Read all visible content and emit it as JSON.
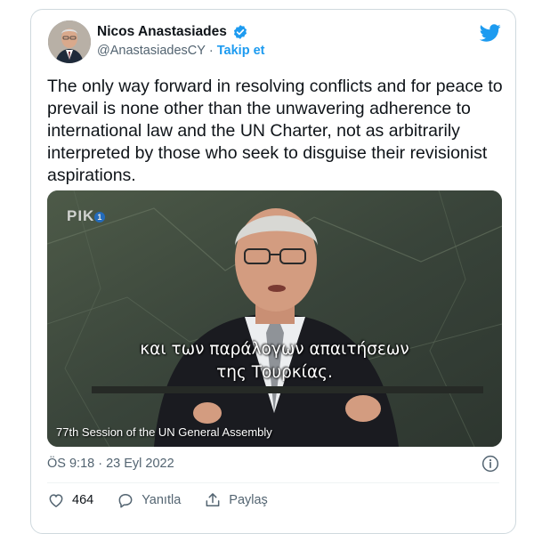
{
  "tweet": {
    "author_name": "Nicos Anastasiades",
    "handle": "@AnastasiadesCY",
    "separator": "·",
    "follow_label": "Takip et",
    "text": "The only way forward in resolving conflicts and for peace to prevail is none other than the unwavering adherence to international law and the UN Charter, not as arbitrarily interpreted by those who seek to disguise their revisionist aspirations.",
    "timestamp": "ÖS 9:18 · 23 Eyl 2022"
  },
  "video": {
    "channel_logo": "PIK",
    "channel_logo_badge": "1",
    "subtitle_line1": "και των παράλογων απαιτήσεων",
    "subtitle_line2": "της Τουρκίας.",
    "caption": "77th Session of the UN General Assembly"
  },
  "actions": {
    "like_count": "464",
    "reply_label": "Yanıtla",
    "share_label": "Paylaş"
  },
  "colors": {
    "accent": "#1d9bf0",
    "muted": "#536471",
    "border": "#cfd9de",
    "like": "#f91880"
  },
  "icons": [
    "avatar-photo",
    "verified-badge-icon",
    "twitter-bird-icon",
    "info-icon",
    "heart-icon",
    "reply-icon",
    "share-icon"
  ]
}
